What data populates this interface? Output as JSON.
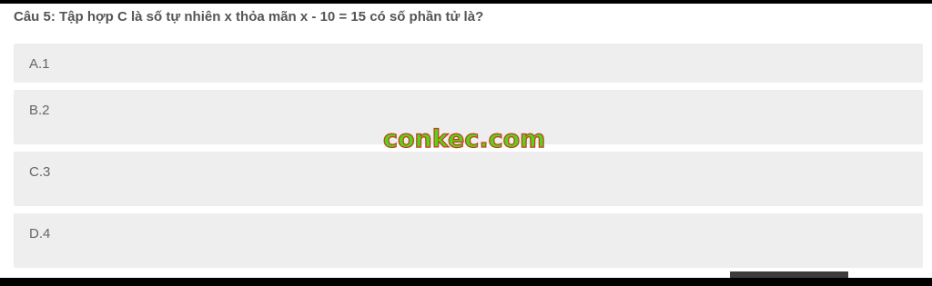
{
  "question": {
    "text": "Câu 5: Tập hợp C là số tự nhiên x thỏa mãn x - 10 = 15 có số phần tử là?"
  },
  "options": [
    {
      "label": "A.1"
    },
    {
      "label": "B.2"
    },
    {
      "label": "C.3"
    },
    {
      "label": "D.4"
    }
  ],
  "watermark": {
    "text": "conkec.com",
    "fill_color": "#58d316",
    "stroke_color": "#c73a1f"
  },
  "colors": {
    "option_background": "#eeeeee",
    "question_text": "#555555",
    "option_text": "#666666"
  }
}
